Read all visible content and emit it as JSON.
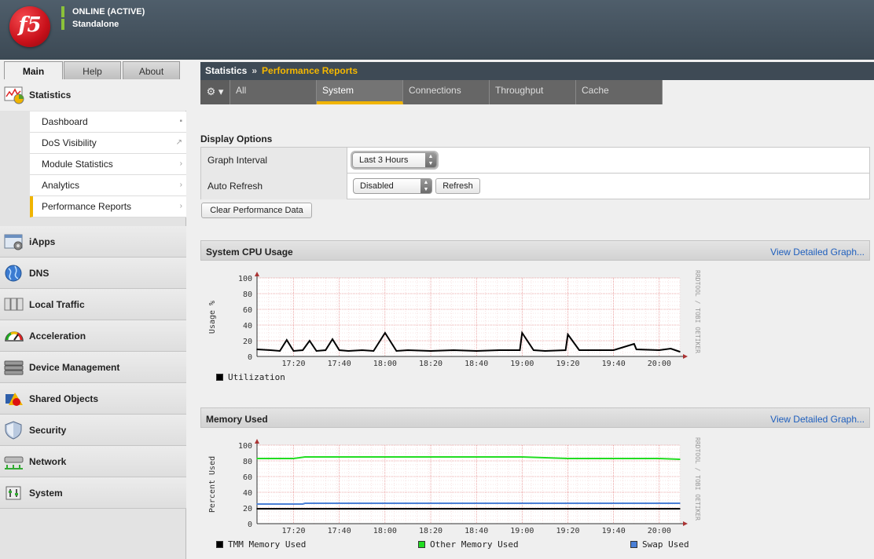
{
  "header": {
    "logo_text": "f5",
    "status": "ONLINE (ACTIVE)",
    "mode": "Standalone"
  },
  "top_tabs": [
    "Main",
    "Help",
    "About"
  ],
  "nav": {
    "statistics": "Statistics",
    "submenu": [
      {
        "label": "Dashboard",
        "arrow": "▪"
      },
      {
        "label": "DoS Visibility",
        "arrow": "↗"
      },
      {
        "label": "Module Statistics",
        "arrow": "›"
      },
      {
        "label": "Analytics",
        "arrow": "›"
      },
      {
        "label": "Performance Reports",
        "arrow": "›"
      }
    ],
    "sections": [
      "iApps",
      "DNS",
      "Local Traffic",
      "Acceleration",
      "Device Management",
      "Shared Objects",
      "Security",
      "Network",
      "System"
    ]
  },
  "breadcrumb": {
    "root": "Statistics",
    "sep": "»",
    "current": "Performance Reports"
  },
  "subtabs": {
    "gear": "⚙ ▾",
    "items": [
      "All",
      "System",
      "Connections",
      "Throughput",
      "Cache"
    ]
  },
  "display": {
    "title": "Display Options",
    "graph_interval_label": "Graph Interval",
    "graph_interval_value": "Last 3 Hours",
    "auto_refresh_label": "Auto Refresh",
    "auto_refresh_value": "Disabled",
    "refresh_button": "Refresh",
    "clear_button": "Clear Performance Data"
  },
  "panels": {
    "cpu_title": "System CPU Usage",
    "mem_title": "Memory Used",
    "detail_link": "View Detailed Graph..."
  },
  "chart_data": [
    {
      "type": "line",
      "title": "",
      "ylabel": "Usage %",
      "xlabel": "",
      "ylim": [
        0,
        100
      ],
      "yticks": [
        "100",
        "80",
        "60",
        "40",
        "20",
        "0"
      ],
      "xticks": [
        "17:20",
        "17:40",
        "18:00",
        "18:20",
        "18:40",
        "19:00",
        "19:20",
        "19:40",
        "20:00"
      ],
      "watermark": "RRDTOOL / TOBI OETIKER",
      "grid": true,
      "series": [
        {
          "name": "Utilization",
          "color": "#000000",
          "x": [
            "17:04",
            "17:10",
            "17:14",
            "17:17",
            "17:20",
            "17:24",
            "17:27",
            "17:30",
            "17:34",
            "17:37",
            "17:40",
            "17:44",
            "17:50",
            "17:55",
            "18:00",
            "18:05",
            "18:10",
            "18:20",
            "18:30",
            "18:40",
            "18:50",
            "18:59",
            "19:00",
            "19:05",
            "19:10",
            "19:19",
            "19:20",
            "19:25",
            "19:30",
            "19:40",
            "19:49",
            "19:50",
            "20:00",
            "20:05",
            "20:09"
          ],
          "values": [
            9,
            8,
            7,
            21,
            7,
            8,
            20,
            7,
            8,
            22,
            8,
            7,
            8,
            7,
            30,
            7,
            8,
            7,
            8,
            7,
            8,
            8,
            30,
            8,
            7,
            8,
            28,
            8,
            8,
            8,
            16,
            9,
            8,
            10,
            6
          ]
        }
      ]
    },
    {
      "type": "line",
      "title": "",
      "ylabel": "Percent Used",
      "xlabel": "",
      "ylim": [
        0,
        100
      ],
      "yticks": [
        "100",
        "80",
        "60",
        "40",
        "20",
        "0"
      ],
      "xticks": [
        "17:20",
        "17:40",
        "18:00",
        "18:20",
        "18:40",
        "19:00",
        "19:20",
        "19:40",
        "20:00"
      ],
      "watermark": "RRDTOOL / TOBI OETIKER",
      "grid": true,
      "series": [
        {
          "name": "TMM Memory Used",
          "color": "#000000",
          "x": [
            "17:04",
            "20:09"
          ],
          "values": [
            19,
            19
          ]
        },
        {
          "name": "Other Memory Used",
          "color": "#22dd22",
          "x": [
            "17:04",
            "17:20",
            "17:25",
            "17:40",
            "18:00",
            "18:20",
            "18:40",
            "19:00",
            "19:10",
            "19:20",
            "19:40",
            "20:00",
            "20:09"
          ],
          "values": [
            83,
            83,
            85,
            85,
            85,
            85,
            85,
            85,
            84,
            83,
            83,
            83,
            82
          ]
        },
        {
          "name": "Swap Used",
          "color": "#4a7fd6",
          "x": [
            "17:04",
            "17:24",
            "17:25",
            "20:09"
          ],
          "values": [
            25,
            25,
            26,
            26
          ]
        }
      ]
    }
  ]
}
